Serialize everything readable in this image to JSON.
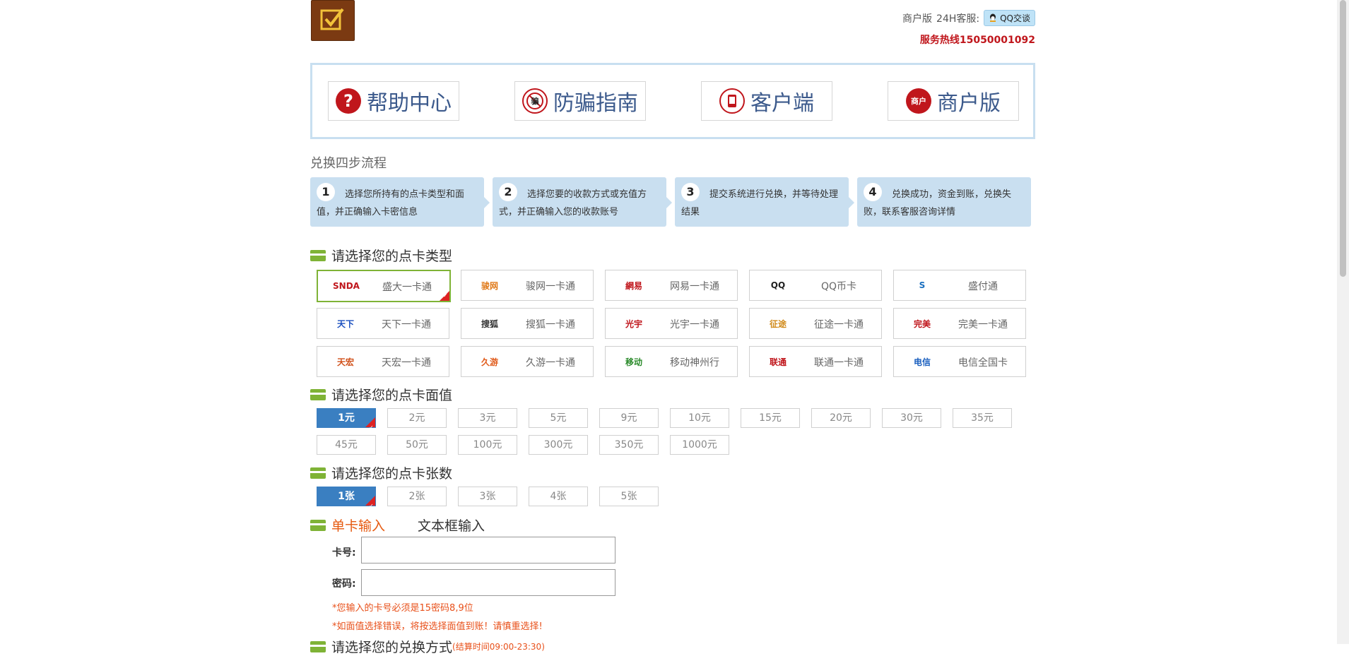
{
  "header": {
    "merchant_label": "商户版",
    "service_label": "24H客服:",
    "qq_button": "QQ交谈",
    "hotline": "服务热线15050001092"
  },
  "nav": [
    {
      "label": "帮助中心",
      "icon": "question-icon"
    },
    {
      "label": "防骗指南",
      "icon": "anti-fraud-icon"
    },
    {
      "label": "客户端",
      "icon": "phone-icon"
    },
    {
      "label": "商户版",
      "icon": "merchant-badge-icon",
      "icon_text": "商户"
    }
  ],
  "steps": {
    "title": "兑换四步流程",
    "items": [
      {
        "num": "1",
        "text": "选择您所持有的点卡类型和面值，并正确输入卡密信息"
      },
      {
        "num": "2",
        "text": "选择您要的收款方式或充值方式，并正确输入您的收款账号"
      },
      {
        "num": "3",
        "text": "提交系统进行兑换，并等待处理结果"
      },
      {
        "num": "4",
        "text": "兑换成功，资金到账，兑换失败，联系客服咨询详情"
      }
    ]
  },
  "card_type": {
    "title": "请选择您的点卡类型",
    "selected": "盛大一卡通",
    "items": [
      {
        "name": "盛大一卡通",
        "brand": "SNDA",
        "color": "#c0161c"
      },
      {
        "name": "骏网一卡通",
        "brand": "骏网",
        "color": "#e07a1a"
      },
      {
        "name": "网易一卡通",
        "brand": "網易",
        "color": "#c0161c"
      },
      {
        "name": "QQ币卡",
        "brand": "QQ",
        "color": "#222222"
      },
      {
        "name": "盛付通",
        "brand": "S",
        "color": "#1a6fbf"
      },
      {
        "name": "天下一卡通",
        "brand": "天下",
        "color": "#1a4fbf"
      },
      {
        "name": "搜狐一卡通",
        "brand": "搜狐",
        "color": "#333333"
      },
      {
        "name": "光宇一卡通",
        "brand": "光宇",
        "color": "#c0161c"
      },
      {
        "name": "征途一卡通",
        "brand": "征途",
        "color": "#d08a1a"
      },
      {
        "name": "完美一卡通",
        "brand": "完美",
        "color": "#c0161c"
      },
      {
        "name": "天宏一卡通",
        "brand": "天宏",
        "color": "#d0501a"
      },
      {
        "name": "久游一卡通",
        "brand": "久游",
        "color": "#e05a1a"
      },
      {
        "name": "移动神州行",
        "brand": "移动",
        "color": "#2a8a2a"
      },
      {
        "name": "联通一卡通",
        "brand": "联通",
        "color": "#c0161c"
      },
      {
        "name": "电信全国卡",
        "brand": "电信",
        "color": "#1a5fbf"
      }
    ]
  },
  "face_value": {
    "title": "请选择您的点卡面值",
    "selected": "1元",
    "items": [
      "1元",
      "2元",
      "3元",
      "5元",
      "9元",
      "10元",
      "15元",
      "20元",
      "30元",
      "35元",
      "45元",
      "50元",
      "100元",
      "300元",
      "350元",
      "1000元"
    ]
  },
  "card_count": {
    "title": "请选择您的点卡张数",
    "selected": "1张",
    "items": [
      "1张",
      "2张",
      "3张",
      "4张",
      "5张"
    ]
  },
  "input_mode": {
    "active_tab": "单卡输入",
    "other_tab": "文本框输入"
  },
  "form": {
    "card_no_label": "卡号:",
    "password_label": "密码:",
    "card_no_value": "",
    "password_value": "",
    "note1": "*您输入的卡号必须是15密码8,9位",
    "note2": "*如面值选择错误，将按选择面值到账！请慎重选择!"
  },
  "next_section": {
    "title": "请选择您的兑换方式",
    "hint": "(结算时间09:00-23:30)"
  },
  "colors": {
    "accent_green": "#7fb336",
    "selected_blue": "#3a7fc1",
    "hotline_red": "#c0161c",
    "step_bg": "#c9dff0",
    "warning_orange": "#e8501a"
  }
}
